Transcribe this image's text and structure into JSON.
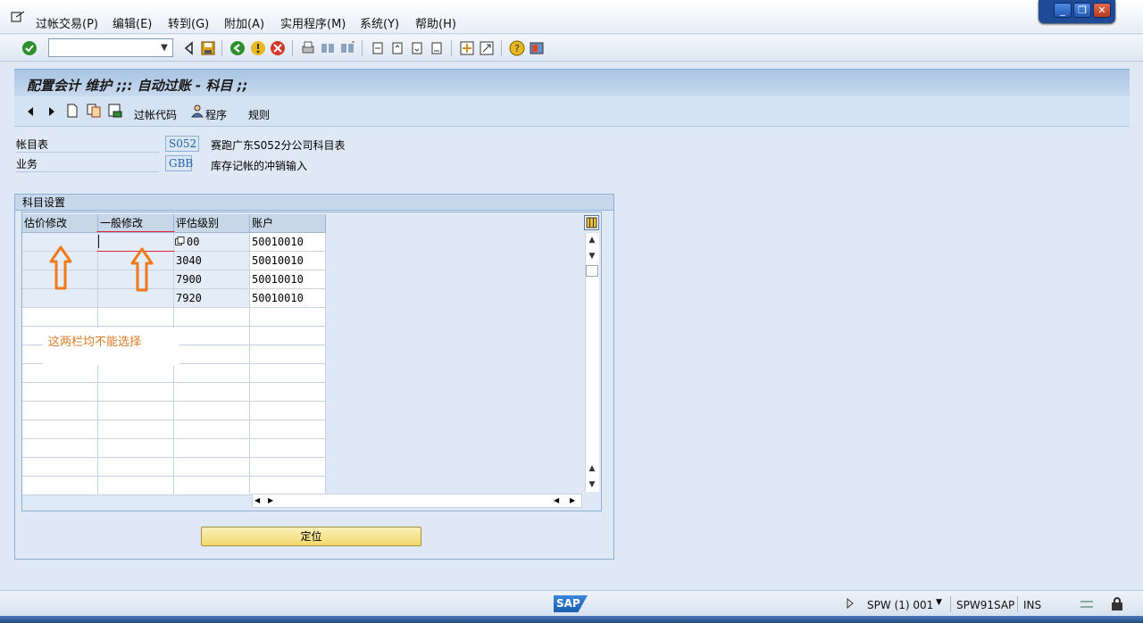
{
  "menu": [
    "过帐交易(P)",
    "编辑(E)",
    "转到(G)",
    "附加(A)",
    "实用程序(M)",
    "系统(Y)",
    "帮助(H)"
  ],
  "window_controls": {
    "minimize": "_",
    "restore": "❐",
    "close": "✕"
  },
  "toolbar": {
    "command_value": ""
  },
  "title": "配置会计 维护 ;;:  自动过账 - 科目 ;;",
  "app_toolbar": {
    "posting_code": "过帐代码",
    "program": "程序",
    "rules": "规则"
  },
  "fields": [
    {
      "label": "帐目表",
      "value": "S052",
      "desc": "赛跑广东S052分公司科目表"
    },
    {
      "label": "业务",
      "value": "GBB",
      "desc": "库存记帐的冲销输入"
    }
  ],
  "group_title": "科目设置",
  "table": {
    "columns": [
      "估价修改",
      "一般修改",
      "评估级别",
      "账户"
    ],
    "rows": [
      [
        "",
        "",
        "00",
        "50010010"
      ],
      [
        "",
        "",
        "3040",
        "50010010"
      ],
      [
        "",
        "",
        "7900",
        "50010010"
      ],
      [
        "",
        "",
        "7920",
        "50010010"
      ]
    ]
  },
  "annotation": "这两栏均不能选择",
  "locate_button": "定位",
  "status": {
    "logo": "SAP",
    "session": "SPW (1) 001",
    "server": "SPW91SAP",
    "mode": "INS"
  },
  "colors": {
    "accent_blue": "#1f4a96",
    "annotation_orange": "#f07a1a",
    "frame_blue": "#8fb0d6"
  }
}
